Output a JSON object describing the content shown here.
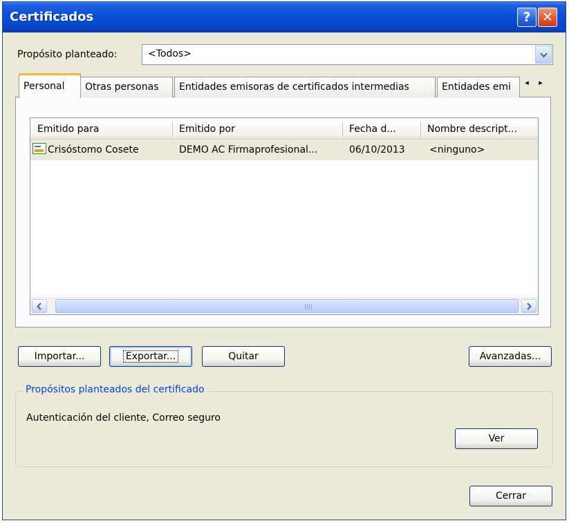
{
  "window": {
    "title": "Certificados",
    "help_label": "?",
    "close_label": "✕"
  },
  "purpose": {
    "label": "Propósito planteado:",
    "selected": "<Todos>"
  },
  "tabs": [
    {
      "label": "Personal"
    },
    {
      "label": "Otras personas"
    },
    {
      "label": "Entidades emisoras de certificados intermedias"
    },
    {
      "label": "Entidades emi"
    }
  ],
  "tab_scroll": {
    "left": "◂",
    "right": "▸"
  },
  "list": {
    "columns": [
      "Emitido para",
      "Emitido por",
      "Fecha d...",
      "Nombre descript..."
    ],
    "rows": [
      {
        "issued_to": "Crisóstomo Cosete",
        "issued_by": "DEMO AC Firmaprofesional...",
        "date": "06/10/2013",
        "friendly_name": "<ninguno>",
        "icon": "certificate-icon"
      }
    ]
  },
  "buttons": {
    "import": "Importar...",
    "export": "Exportar...",
    "remove": "Quitar",
    "advanced": "Avanzadas...",
    "view": "Ver",
    "close": "Cerrar"
  },
  "purposes_group": {
    "title": "Propósitos planteados del certificado",
    "text": "Autenticación del cliente, Correo seguro"
  },
  "colors": {
    "titlebar": "#0a4fd8",
    "dialog_bg": "#ece9d8",
    "selected_row": "#ece9d8",
    "group_title": "#0046d5",
    "tab_highlight": "#f5b43c"
  }
}
